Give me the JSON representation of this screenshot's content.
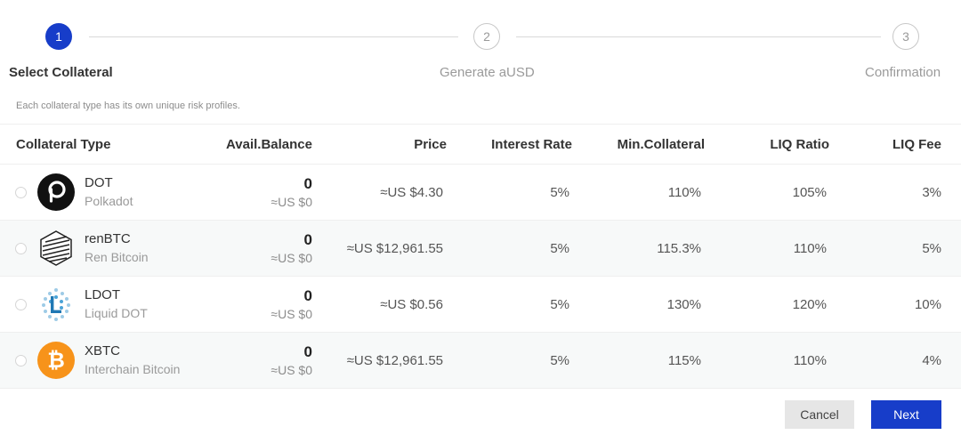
{
  "stepper": {
    "steps": [
      {
        "number": "1",
        "label": "Select Collateral",
        "active": true
      },
      {
        "number": "2",
        "label": "Generate aUSD",
        "active": false
      },
      {
        "number": "3",
        "label": "Confirmation",
        "active": false
      }
    ]
  },
  "note": "Each collateral type has its own unique risk profiles.",
  "table": {
    "headers": {
      "type": "Collateral Type",
      "balance": "Avail.Balance",
      "price": "Price",
      "interest": "Interest Rate",
      "min_collateral": "Min.Collateral",
      "liq_ratio": "LIQ Ratio",
      "liq_fee": "LIQ Fee"
    },
    "rows": [
      {
        "symbol": "DOT",
        "name": "Polkadot",
        "icon": "polkadot-logo-icon",
        "balance": "0",
        "balance_usd": "≈US $0",
        "price": "≈US $4.30",
        "interest": "5%",
        "min_collateral": "110%",
        "liq_ratio": "105%",
        "liq_fee": "3%"
      },
      {
        "symbol": "renBTC",
        "name": "Ren Bitcoin",
        "icon": "renbtc-logo-icon",
        "balance": "0",
        "balance_usd": "≈US $0",
        "price": "≈US $12,961.55",
        "interest": "5%",
        "min_collateral": "115.3%",
        "liq_ratio": "110%",
        "liq_fee": "5%"
      },
      {
        "symbol": "LDOT",
        "name": "Liquid DOT",
        "icon": "ldot-logo-icon",
        "balance": "0",
        "balance_usd": "≈US $0",
        "price": "≈US $0.56",
        "interest": "5%",
        "min_collateral": "130%",
        "liq_ratio": "120%",
        "liq_fee": "10%"
      },
      {
        "symbol": "XBTC",
        "name": "Interchain Bitcoin",
        "icon": "bitcoin-logo-icon",
        "balance": "0",
        "balance_usd": "≈US $0",
        "price": "≈US $12,961.55",
        "interest": "5%",
        "min_collateral": "115%",
        "liq_ratio": "110%",
        "liq_fee": "4%"
      }
    ]
  },
  "buttons": {
    "cancel": "Cancel",
    "next": "Next"
  },
  "colors": {
    "accent": "#173dc9",
    "bitcoin": "#f7931a",
    "ldot": "#4aa3d8"
  }
}
